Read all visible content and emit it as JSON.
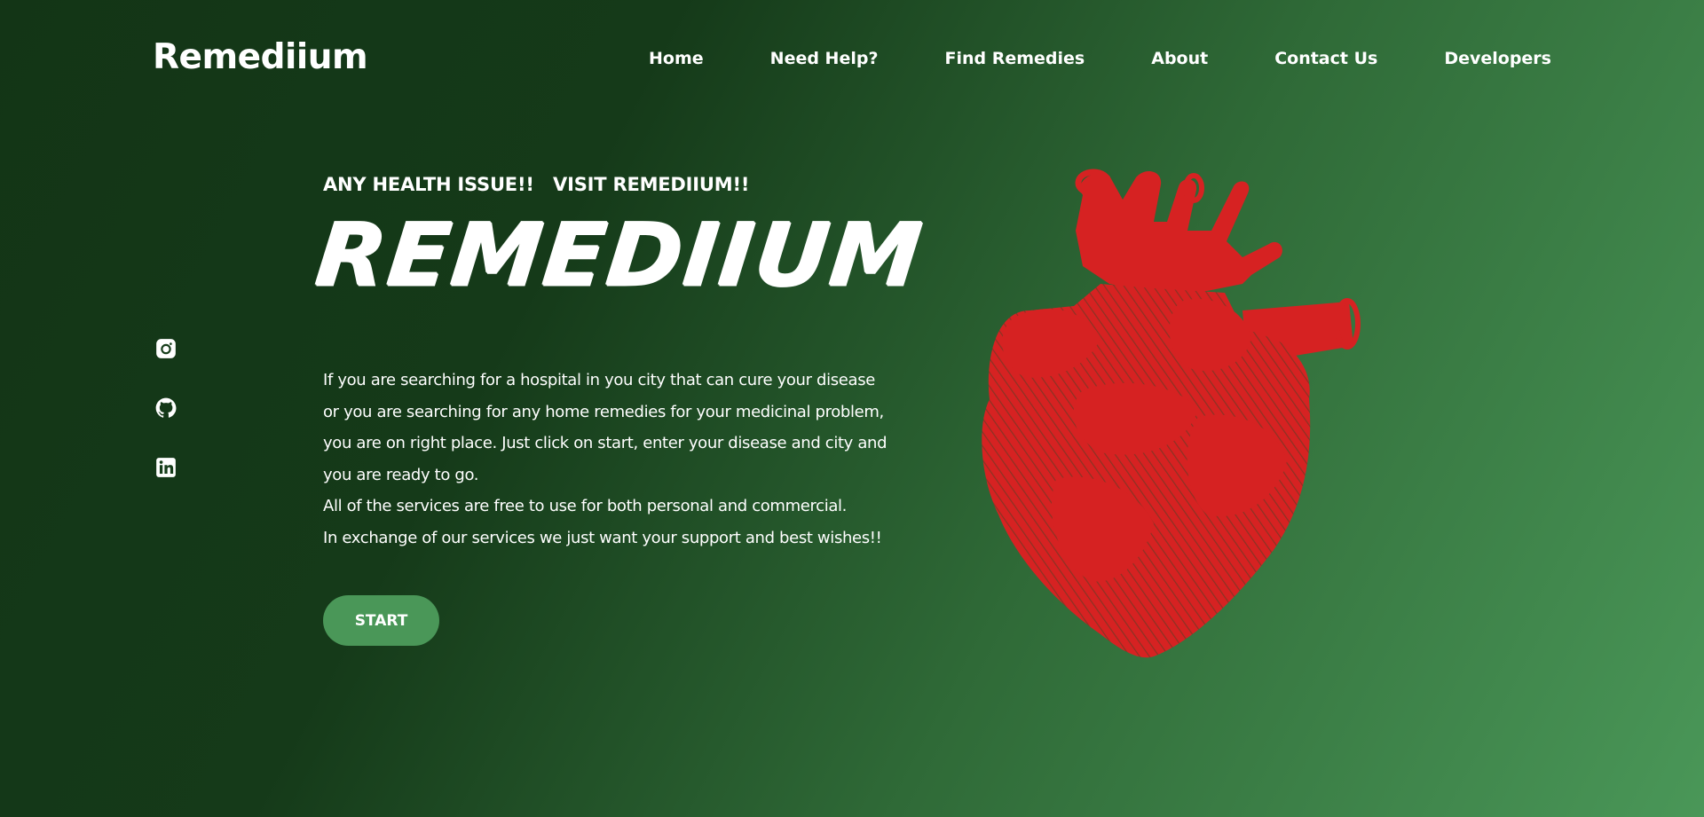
{
  "header": {
    "logo": "Remediium",
    "nav": [
      "Home",
      "Need Help?",
      "Find Remedies",
      "About",
      "Contact Us",
      "Developers"
    ]
  },
  "social": [
    {
      "icon": "instagram-icon"
    },
    {
      "icon": "github-icon"
    },
    {
      "icon": "linkedin-icon"
    }
  ],
  "hero": {
    "tagline": "ANY HEALTH ISSUE!!   VISIT REMEDIIUM!!",
    "title": "REMEDIIUM",
    "description": [
      "If you are searching for a hospital in you city that can cure your disease",
      "or you are searching for any home remedies for your medicinal problem,",
      "you are on right place. Just click on start, enter your disease and city and",
      "you are ready to go.",
      "All of the services are free to use for both personal and commercial.",
      "In exchange of our services we just want your support and best wishes!!"
    ],
    "start_label": "START"
  },
  "illustration": {
    "icon": "heart-illustration",
    "color": "#d62222"
  },
  "colors": {
    "accent": "#4a9758",
    "background_dark": "#133516",
    "background_light": "#4a9758"
  }
}
